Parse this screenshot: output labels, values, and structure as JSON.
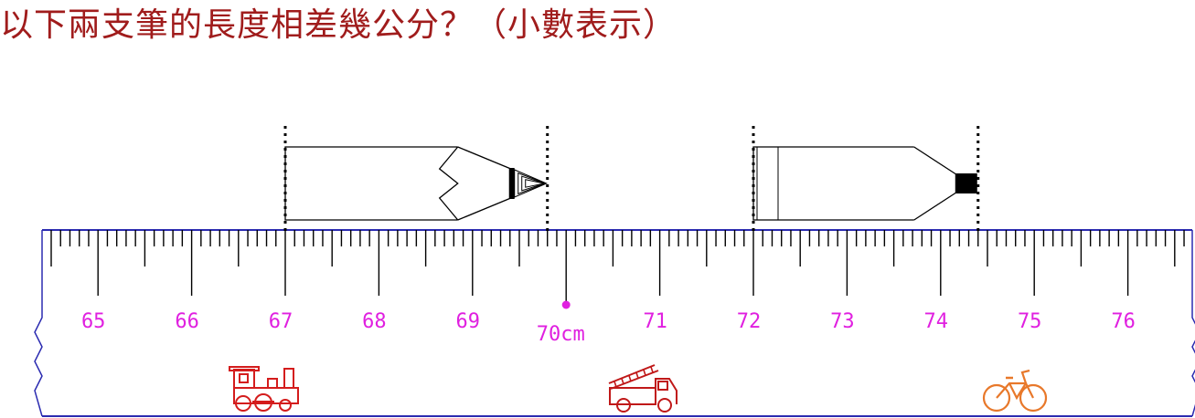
{
  "question": "以下兩支筆的長度相差幾公分？（小數表示）",
  "ruler": {
    "start_cm": 64.5,
    "end_cm": 76.8,
    "labeled_cm": [
      65,
      66,
      67,
      68,
      69,
      70,
      71,
      72,
      73,
      74,
      75,
      76
    ],
    "highlight_cm": 70,
    "unit_label": "cm",
    "label_color": "#e020e0",
    "line_color": "#2b2bb0"
  },
  "pencil": {
    "name": "pencil",
    "start_cm": 67.0,
    "end_cm": 69.8
  },
  "pen": {
    "name": "marker-pen",
    "start_cm": 72.0,
    "end_cm": 74.4
  },
  "decorations": [
    {
      "icon": "train-icon",
      "color": "#d41c1c"
    },
    {
      "icon": "fire-truck-icon",
      "color": "#c01818"
    },
    {
      "icon": "bicycle-icon",
      "color": "#e8782a"
    }
  ]
}
